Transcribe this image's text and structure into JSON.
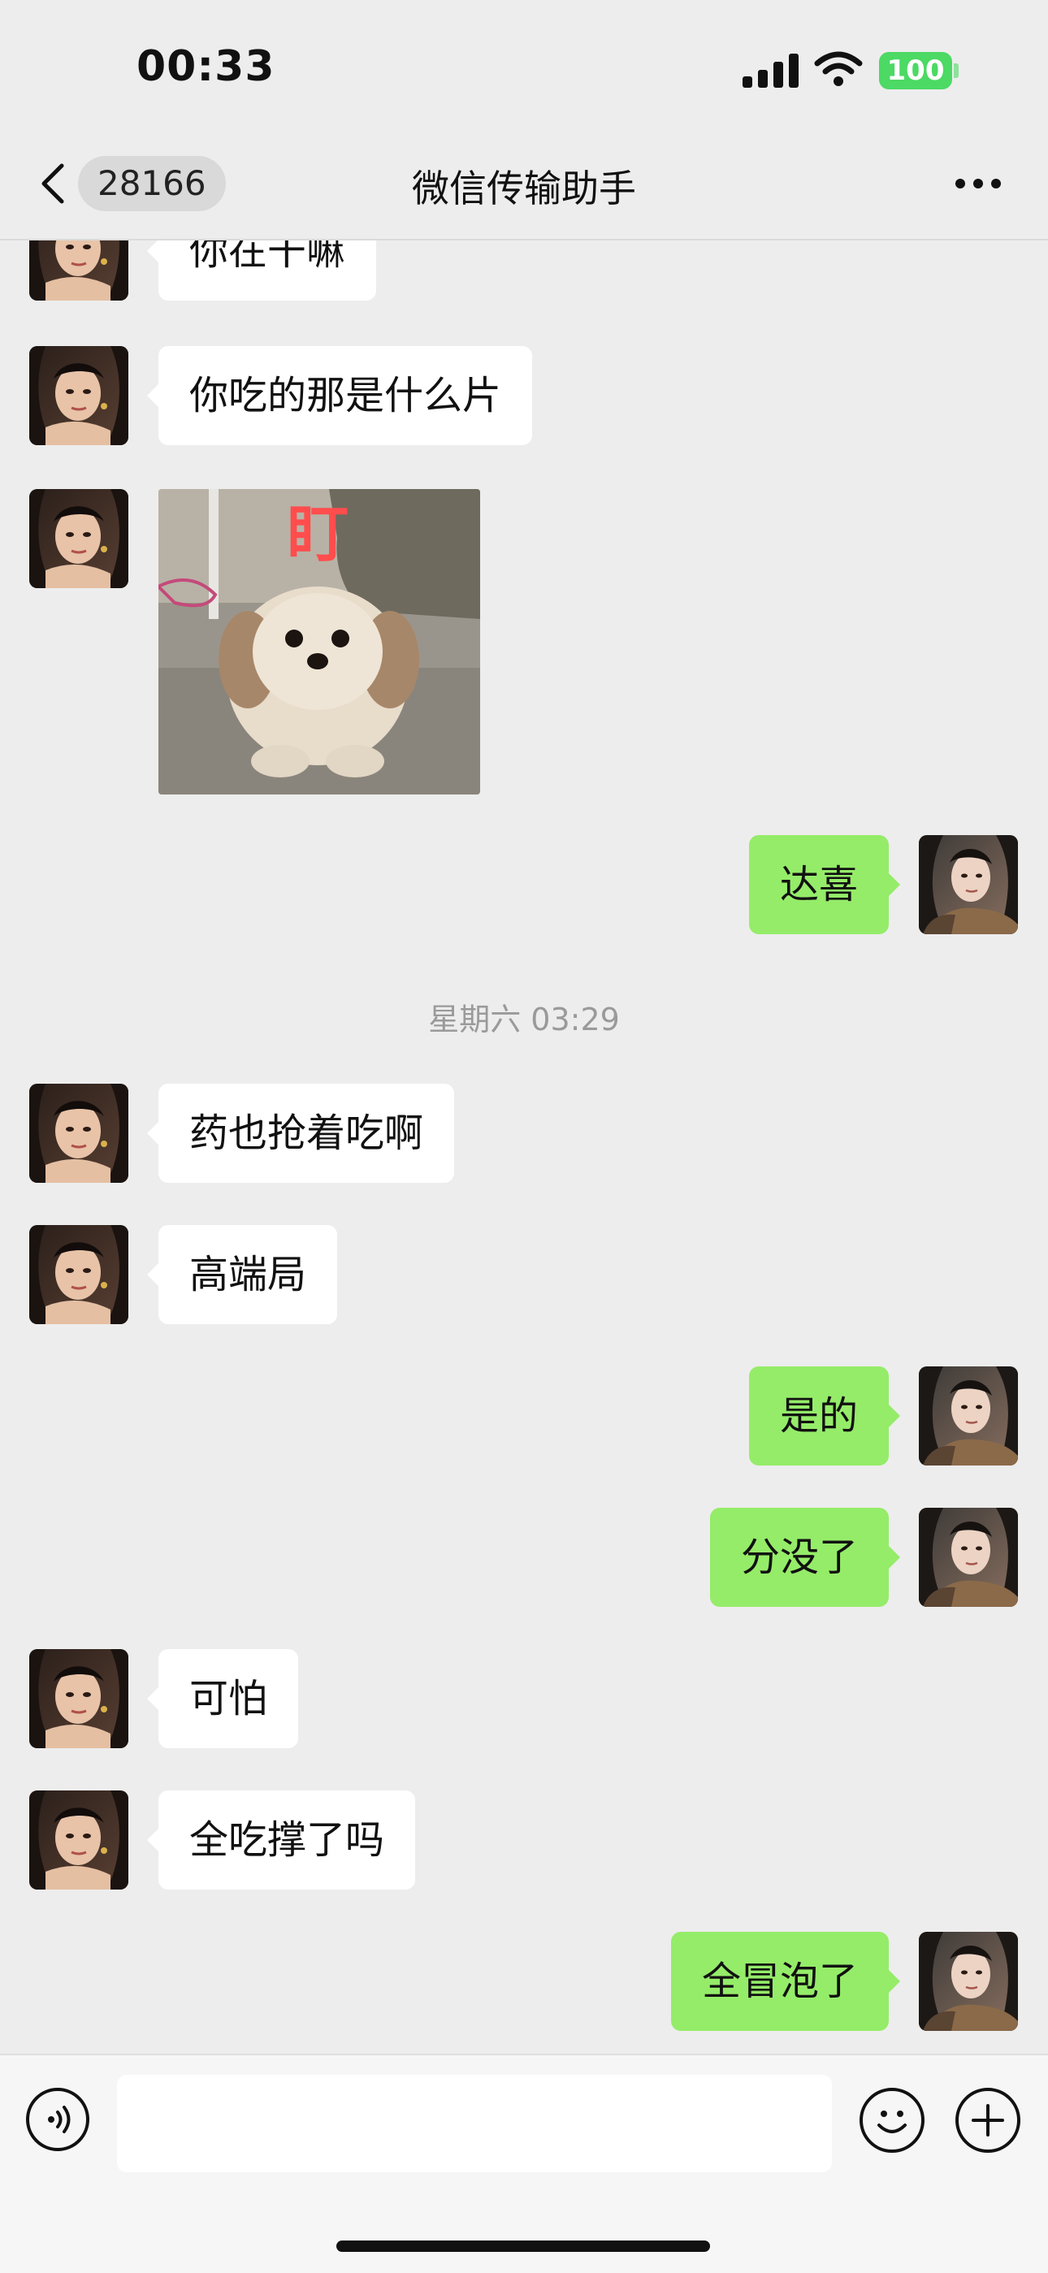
{
  "status_bar": {
    "time": "00:33",
    "battery": "100"
  },
  "nav": {
    "back_badge": "28166",
    "title": "微信传输助手",
    "more_icon": "more-dots-icon"
  },
  "messages": [
    {
      "side": "left",
      "type": "text",
      "text": "你在干嘛"
    },
    {
      "side": "left",
      "type": "text",
      "text": "你吃的那是什么片"
    },
    {
      "side": "left",
      "type": "image",
      "caption": "盯"
    },
    {
      "side": "right",
      "type": "text",
      "text": "达喜"
    },
    {
      "type": "timestamp",
      "text": "星期六 03:29"
    },
    {
      "side": "left",
      "type": "text",
      "text": "药也抢着吃啊"
    },
    {
      "side": "left",
      "type": "text",
      "text": "高端局"
    },
    {
      "side": "right",
      "type": "text",
      "text": "是的"
    },
    {
      "side": "right",
      "type": "text",
      "text": "分没了"
    },
    {
      "side": "left",
      "type": "text",
      "text": "可怕"
    },
    {
      "side": "left",
      "type": "text",
      "text": "全吃撑了吗"
    },
    {
      "side": "right",
      "type": "text",
      "text": "全冒泡了"
    }
  ],
  "input_bar": {
    "value": "",
    "placeholder": ""
  },
  "colors": {
    "background": "#ededed",
    "sent_bubble": "#95ec69",
    "received_bubble": "#ffffff",
    "battery": "#4cd964",
    "photo_caption": "#ff4d4d"
  }
}
